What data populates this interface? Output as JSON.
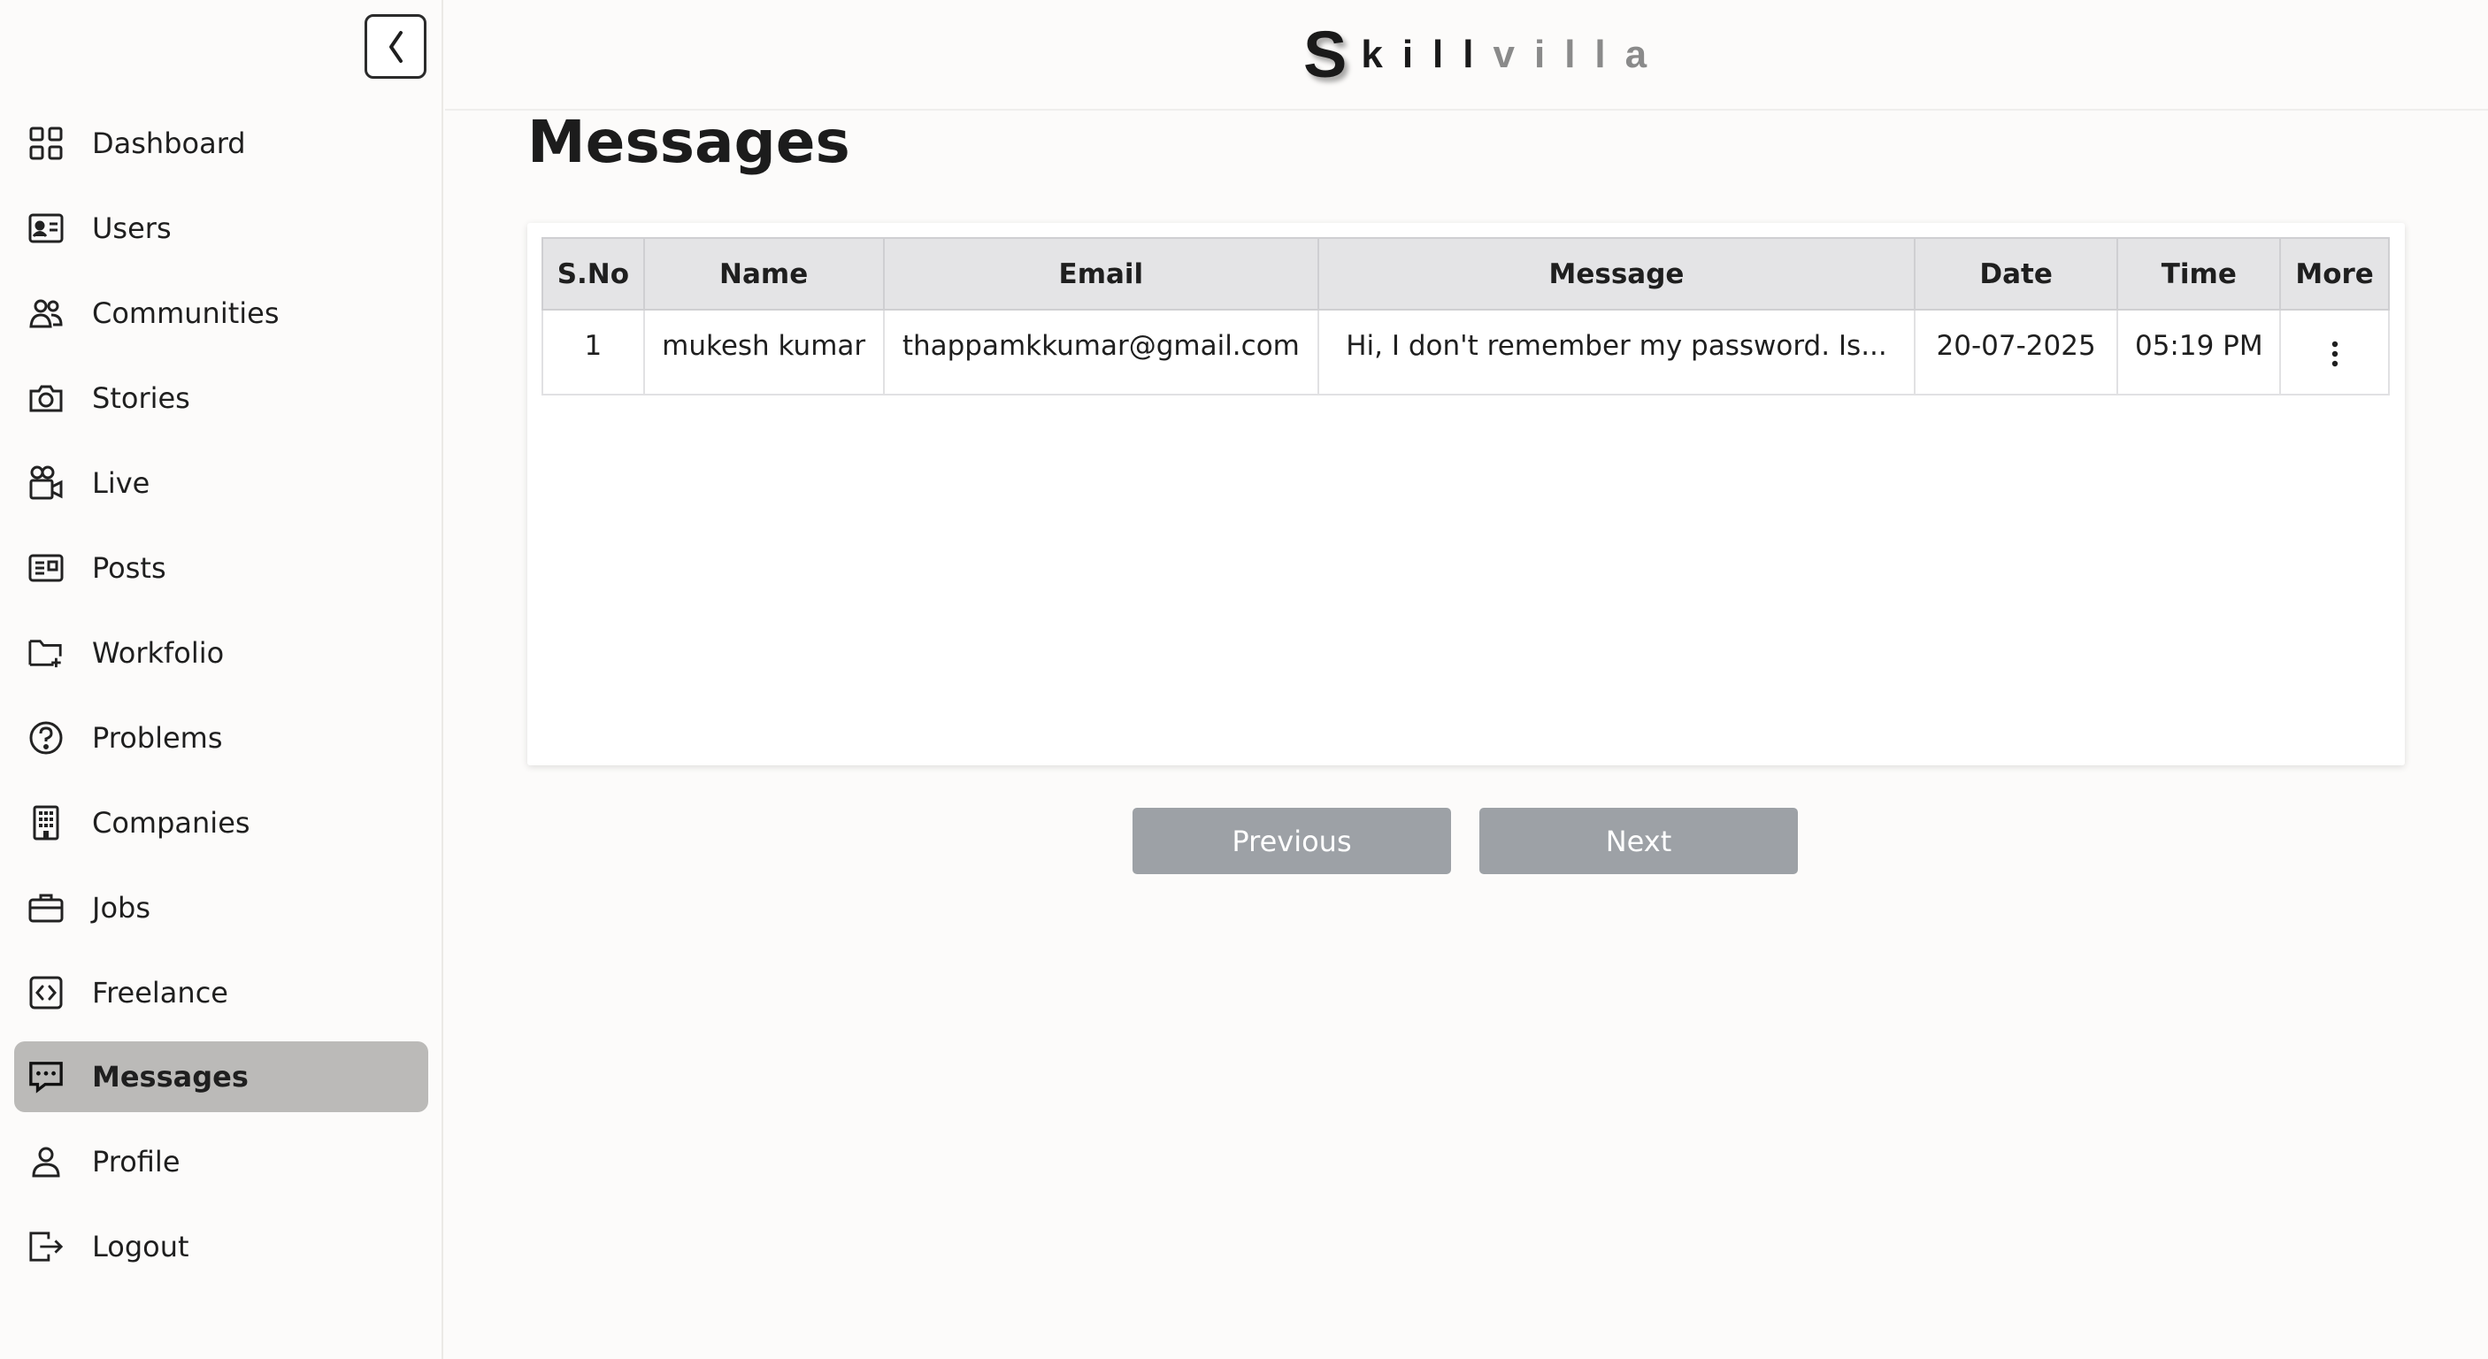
{
  "brand": {
    "letter": "S",
    "dark_part": "kill",
    "grey_part": "villa"
  },
  "sidebar": {
    "items": [
      {
        "label": "Dashboard",
        "icon": "dashboard-grid-icon"
      },
      {
        "label": "Users",
        "icon": "id-card-icon"
      },
      {
        "label": "Communities",
        "icon": "people-icon"
      },
      {
        "label": "Stories",
        "icon": "camera-icon"
      },
      {
        "label": "Live",
        "icon": "video-camera-icon"
      },
      {
        "label": "Posts",
        "icon": "newspaper-icon"
      },
      {
        "label": "Workfolio",
        "icon": "folder-plus-icon"
      },
      {
        "label": "Problems",
        "icon": "question-circle-icon"
      },
      {
        "label": "Companies",
        "icon": "building-icon"
      },
      {
        "label": "Jobs",
        "icon": "briefcase-icon"
      },
      {
        "label": "Freelance",
        "icon": "code-box-icon"
      },
      {
        "label": "Messages",
        "icon": "chat-dots-icon",
        "active": true
      },
      {
        "label": "Profile",
        "icon": "person-icon"
      },
      {
        "label": "Logout",
        "icon": "logout-icon"
      }
    ]
  },
  "main": {
    "title": "Messages",
    "table": {
      "headers": [
        "S.No",
        "Name",
        "Email",
        "Message",
        "Date",
        "Time",
        "More"
      ],
      "rows": [
        {
          "sno": "1",
          "name": "mukesh kumar",
          "email": "thappamkkumar@gmail.com",
          "message": "Hi, I don't remember my password. Is...",
          "date": "20-07-2025",
          "time": "05:19 PM"
        }
      ]
    },
    "pagination": {
      "previous": "Previous",
      "next": "Next"
    }
  },
  "colors": {
    "active_nav": "#bbbab8",
    "button": "#9da1a6",
    "header_bg": "#e4e4e6"
  }
}
